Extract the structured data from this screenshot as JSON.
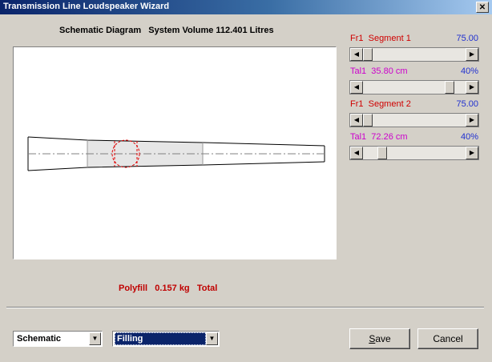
{
  "window": {
    "title": "Transmission Line Loudspeaker Wizard",
    "close_glyph": "✕"
  },
  "diagram": {
    "heading": "Schematic Diagram   System Volume 112.401 Litres",
    "line_color": "#000000",
    "fill_color": "#e6e6e6",
    "centerline_color": "#808080",
    "driver_marker_color": "#e00000"
  },
  "polyfill": {
    "text": "Polyfill   0.157 kg   Total",
    "color": "#c00000"
  },
  "controls": [
    {
      "label": "Fr1  Segment 1",
      "value": "75.00",
      "label_color": "#d00000",
      "value_color": "#2030d0",
      "thumb_position": 0.06
    },
    {
      "label": "Tal1  35.80 cm",
      "value": "40%",
      "label_color": "#cc00cc",
      "value_color": "#2030d0",
      "thumb_position": 0.92
    },
    {
      "label": "Fr1  Segment 2",
      "value": "75.00",
      "label_color": "#d00000",
      "value_color": "#2030d0",
      "thumb_position": 0.06
    },
    {
      "label": "Tal1  72.26 cm",
      "value": "40%",
      "label_color": "#cc00cc",
      "value_color": "#2030d0",
      "thumb_position": 0.18
    }
  ],
  "view_select": {
    "value": "Schematic"
  },
  "mode_select": {
    "value": "Filling"
  },
  "buttons": {
    "save_first": "S",
    "save_rest": "ave",
    "cancel": "Cancel"
  },
  "icons": {
    "left_arrow": "left-arrow-icon",
    "right_arrow": "right-arrow-icon",
    "dropdown": "chevron-down-icon",
    "close": "close-icon"
  }
}
